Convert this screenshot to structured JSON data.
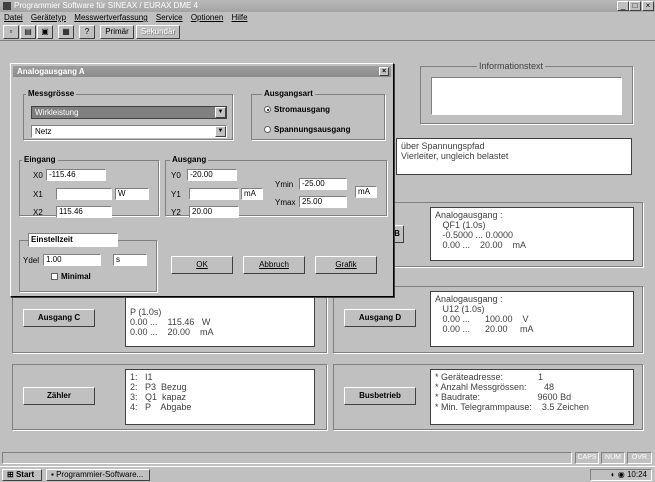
{
  "window": {
    "title": "Programmier Software für SINEAX / EURAX DME 4",
    "min": "_",
    "max": "□",
    "close": "×"
  },
  "menu": [
    "Datei",
    "Gerätetyp",
    "Messwertverfassung",
    "Service",
    "Optionen",
    "Hilfe"
  ],
  "toolbar": {
    "primar": "Primär",
    "sekundar": "Sekundär"
  },
  "info": {
    "title": "Informationstext",
    "text": ""
  },
  "dialog": {
    "title": "Analogausgang A",
    "close": "×",
    "messgrosse": {
      "label": "Messgrösse",
      "value1": "Wirkleistung",
      "value2": "Netz"
    },
    "ausgangsart": {
      "label": "Ausgangsart",
      "opt1": "Stromausgang",
      "opt2": "Spannungsausgang"
    },
    "eingang": {
      "label": "Eingang",
      "x0_label": "X0",
      "x0": "-115.46",
      "x1_label": "X1",
      "x1": "",
      "x1_unit": "W",
      "x2_label": "X2",
      "x2": "115.46"
    },
    "ausgang": {
      "label": "Ausgang",
      "y0_label": "Y0",
      "y0": "-20.00",
      "y1_label": "Y1",
      "y1": "",
      "y1_unit": "mA",
      "y2_label": "Y2",
      "y2": "20.00",
      "ymin_label": "Ymin",
      "ymin": "-25.00",
      "ymax_label": "Ymax",
      "ymax": "25.00",
      "yunit": "mA"
    },
    "einstell": {
      "label": "Einstellzeit",
      "ydel_label": "Ydel",
      "ydel": "1.00",
      "ydel_unit": "s",
      "minimal": "Minimal"
    },
    "buttons": {
      "ok": "OK",
      "abbruch": "Abbruch",
      "grafik": "Grafik"
    }
  },
  "panels": {
    "spannung_text": "über Spannungspfad\nVierleiter, ungleich belastet",
    "ausgang_b": "B",
    "ausgang_b_text": "Analogausgang :\n   QF1 (1.0s)\n   -0.5000 ... 0.0000\n   0.00 ...    20.00    mA",
    "ausgang_c": "Ausgang C",
    "ausgang_c_text": "P (1.0s)\n0.00 ...    115.46   W\n0.00 ...    20.00    mA",
    "ausgang_d": "Ausgang D",
    "ausgang_d_text": "Analogausgang :\n   U12 (1.0s)\n   0.00 ...      100.00    V\n   0.00 ...      20.00     mA",
    "zahler": "Zähler",
    "zahler_text": "1:   I1\n2:   P3  Bezug\n3:   Q1  kapaz\n4:   P    Abgabe",
    "busbetrieb": "Busbetrieb",
    "bus_text": "* Geräteadresse:              1\n* Anzahl Messgrössen:       48\n* Baudrate:                       9600 Bd\n* Min. Telegrammpause:    3.5 Zeichen"
  },
  "status": {
    "caps": "CAPS",
    "num": "NUM",
    "ovr": "OVR"
  },
  "taskbar": {
    "start": "Start",
    "task": "Programmier-Software...",
    "time": "10:24"
  }
}
